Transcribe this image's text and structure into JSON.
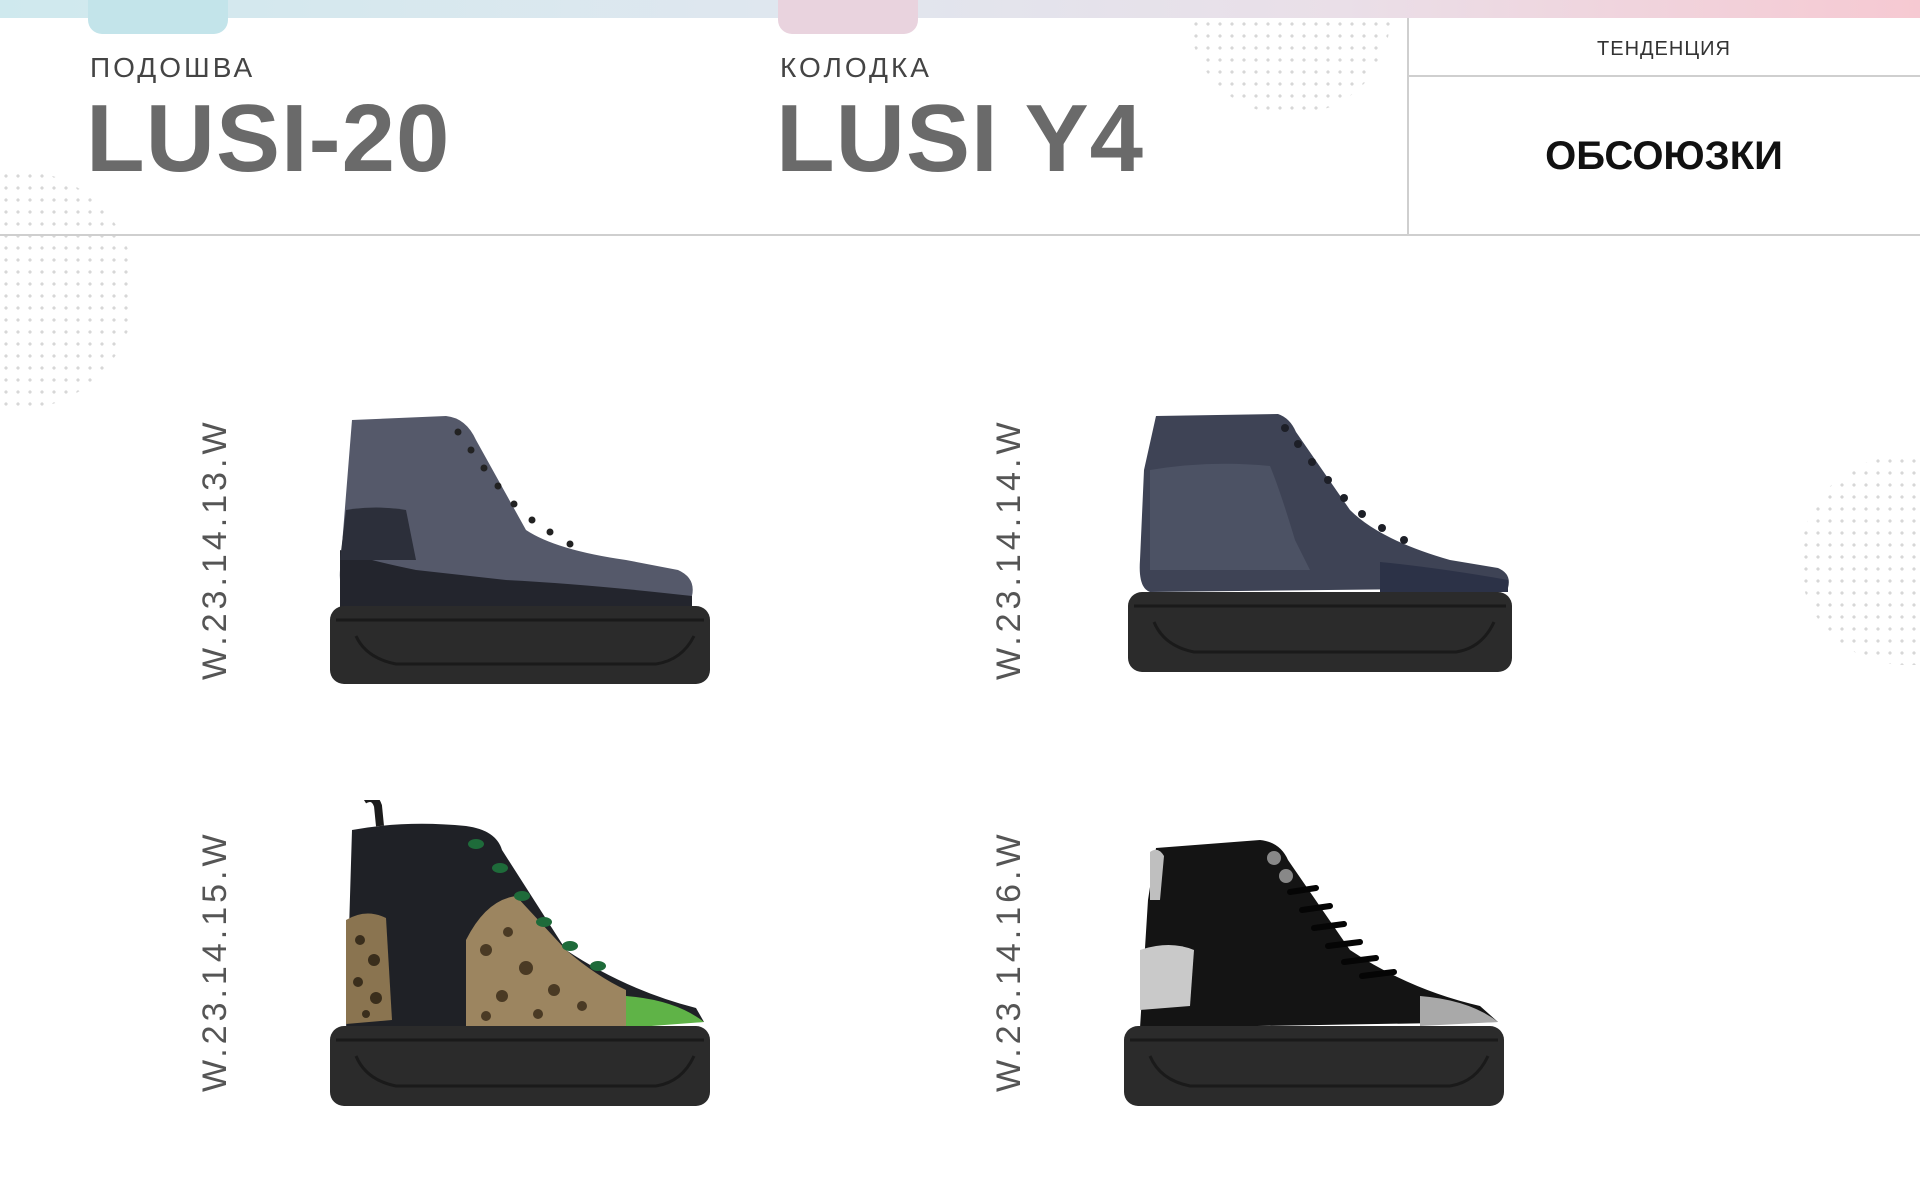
{
  "header": {
    "sole": {
      "label": "ПОДОШВА",
      "value": "LUSI-20"
    },
    "last": {
      "label": "КОЛОДКА",
      "value": "LUSI Y4"
    },
    "trend": {
      "label": "ТЕНДЕНЦИЯ",
      "value": "ОБСОЮЗКИ"
    }
  },
  "products": [
    {
      "code": "W.23.14.13.W",
      "image": "dark-grey-high-top-sneaker"
    },
    {
      "code": "W.23.14.14.W",
      "image": "metallic-blue-high-top-sneaker"
    },
    {
      "code": "W.23.14.15.W",
      "image": "leopard-print-green-toe-high-top-sneaker"
    },
    {
      "code": "W.23.14.16.W",
      "image": "black-silver-high-top-sneaker"
    }
  ],
  "colors": {
    "accent_teal": "#c3e4ea",
    "accent_pink": "#e9d3de",
    "divider": "#cfcfcf"
  }
}
